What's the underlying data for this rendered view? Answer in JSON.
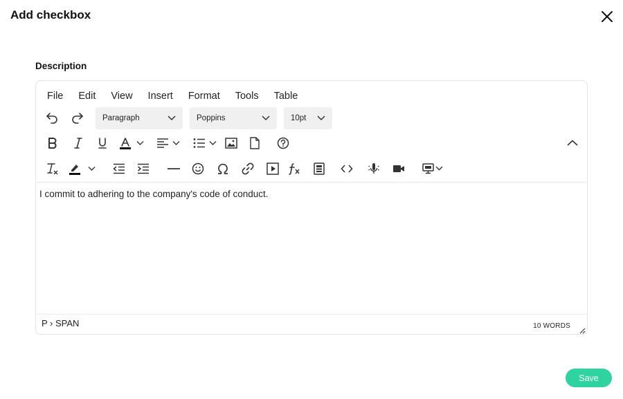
{
  "dialog": {
    "title": "Add checkbox",
    "close_icon": "close-icon"
  },
  "field": {
    "label": "Description"
  },
  "editor": {
    "menu": [
      "File",
      "Edit",
      "View",
      "Insert",
      "Format",
      "Tools",
      "Table"
    ],
    "block_format": "Paragraph",
    "font_family": "Poppins",
    "font_size": "10pt",
    "content": "I commit to adhering to the company's code of conduct.",
    "path": "P › SPAN",
    "word_count": "10 WORDS"
  },
  "actions": {
    "save_label": "Save"
  },
  "colors": {
    "accent": "#2ed3a0",
    "dropdown_bg": "#f0f0f1"
  }
}
